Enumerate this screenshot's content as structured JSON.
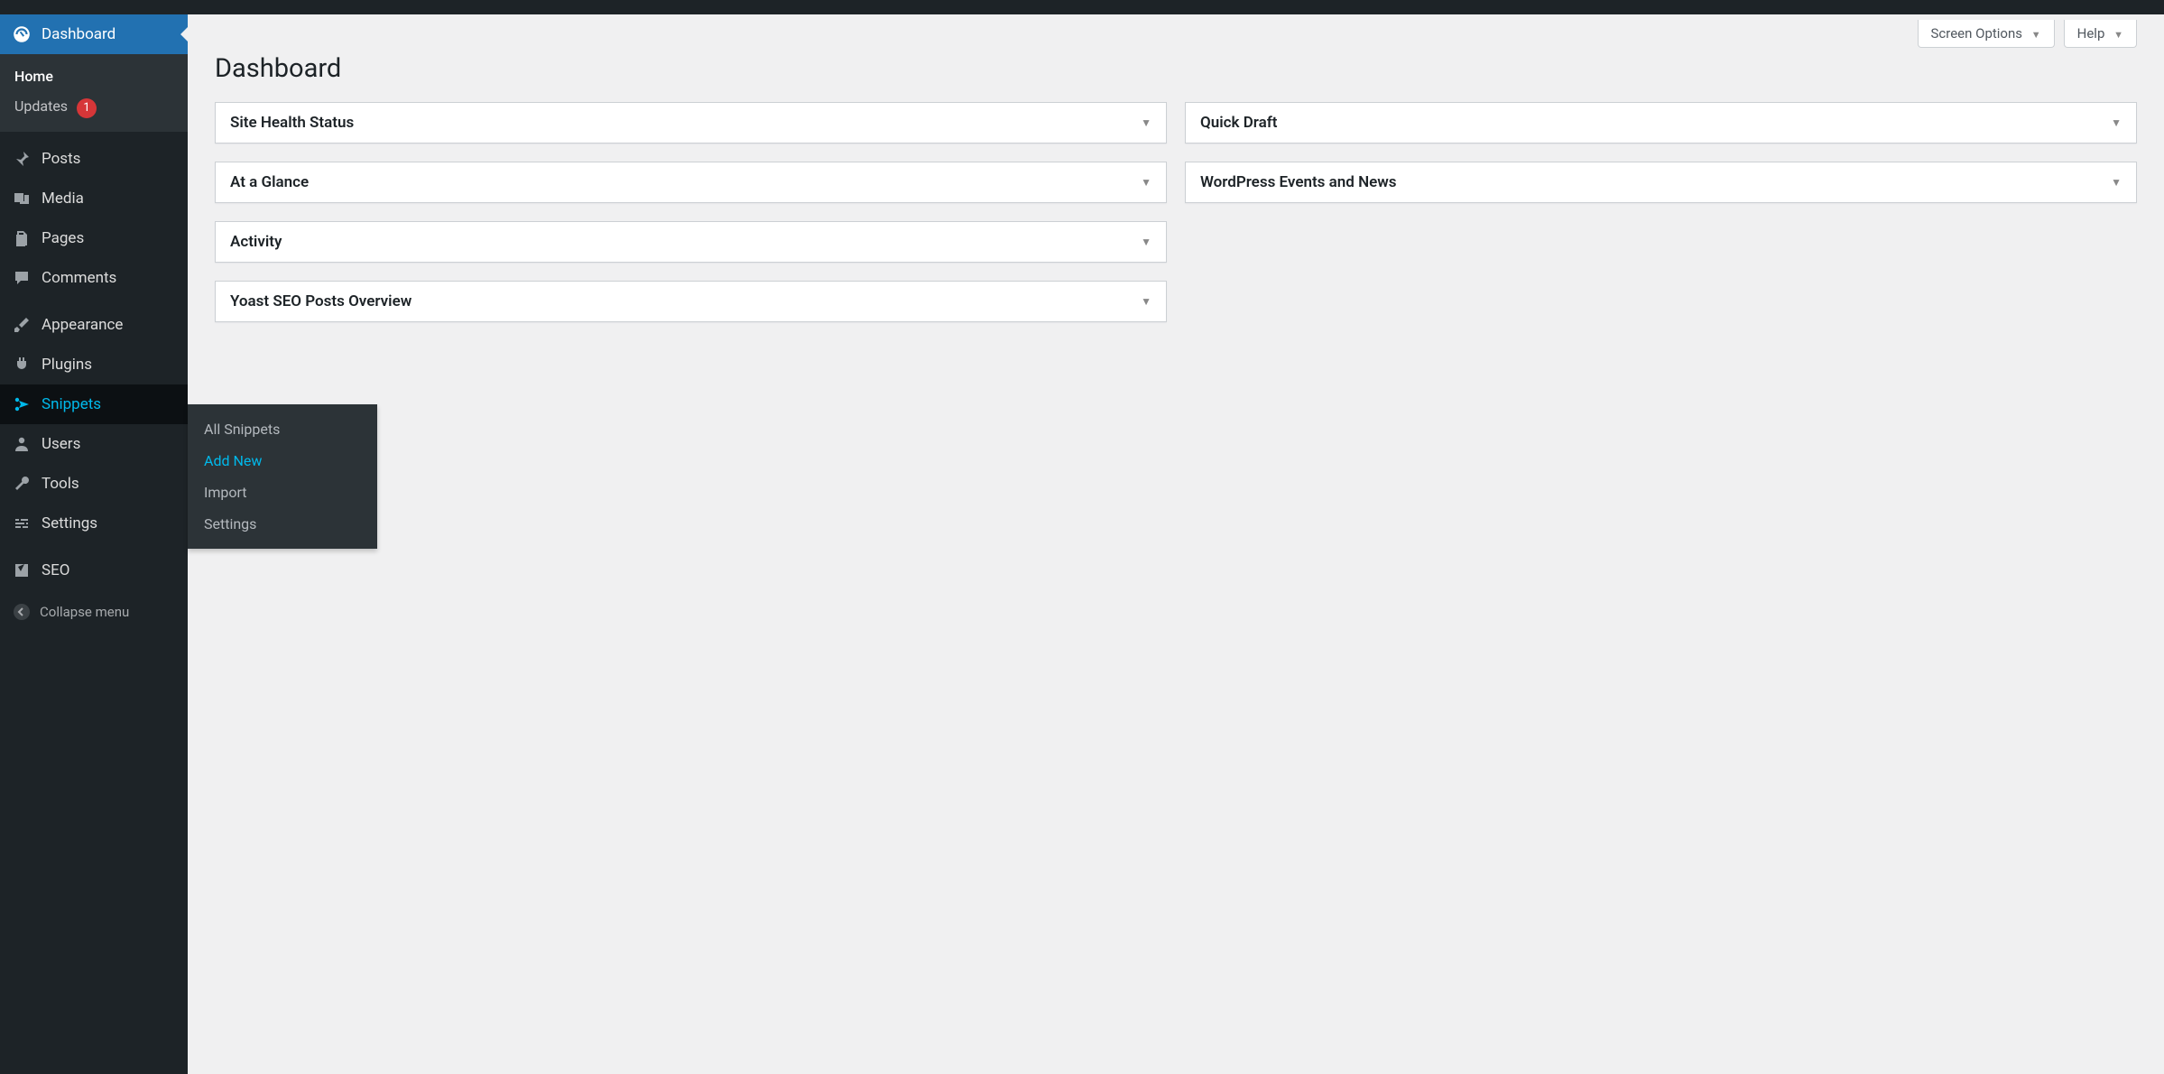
{
  "page_title": "Dashboard",
  "top_tabs": {
    "screen_options": "Screen Options",
    "help": "Help"
  },
  "sidebar": {
    "dashboard": "Dashboard",
    "dash_sub": {
      "home": "Home",
      "updates": "Updates",
      "updates_count": "1"
    },
    "posts": "Posts",
    "media": "Media",
    "pages": "Pages",
    "comments": "Comments",
    "appearance": "Appearance",
    "plugins": "Plugins",
    "snippets": "Snippets",
    "users": "Users",
    "tools": "Tools",
    "settings": "Settings",
    "seo": "SEO",
    "collapse": "Collapse menu"
  },
  "snippets_flyout": {
    "all": "All Snippets",
    "add": "Add New",
    "import": "Import",
    "settings": "Settings"
  },
  "widgets": {
    "left": [
      "Site Health Status",
      "At a Glance",
      "Activity",
      "Yoast SEO Posts Overview"
    ],
    "right": [
      "Quick Draft",
      "WordPress Events and News"
    ]
  }
}
